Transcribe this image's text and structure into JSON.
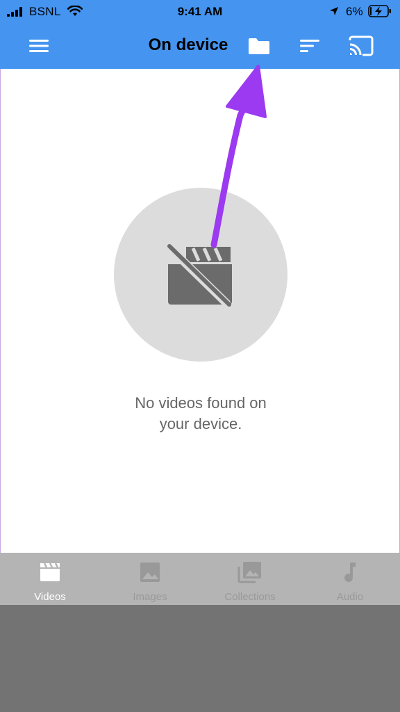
{
  "status_bar": {
    "carrier": "BSNL",
    "time": "9:41 AM",
    "battery_percent": "6%",
    "icons": [
      "signal-icon",
      "wifi-icon",
      "location-arrow-icon",
      "battery-charging-icon"
    ]
  },
  "app_bar": {
    "title": "On device",
    "icons": [
      "menu-icon",
      "folder-icon",
      "sort-icon",
      "cast-icon"
    ]
  },
  "empty_state": {
    "icon": "video-off-icon",
    "message_line1": "No videos found on",
    "message_line2": "your device."
  },
  "bottom_nav": {
    "items": [
      {
        "label": "Videos",
        "icon": "clapperboard-icon",
        "active": true
      },
      {
        "label": "Images",
        "icon": "image-icon",
        "active": false
      },
      {
        "label": "Collections",
        "icon": "collections-icon",
        "active": false
      },
      {
        "label": "Audio",
        "icon": "music-note-icon",
        "active": false
      }
    ]
  },
  "colors": {
    "app_bar": "#4494f0",
    "annotation_arrow": "#9b3af0",
    "bottom_nav": "#b4b4b4",
    "bottom_area": "#737373",
    "empty_circle": "#dcdcdc"
  }
}
